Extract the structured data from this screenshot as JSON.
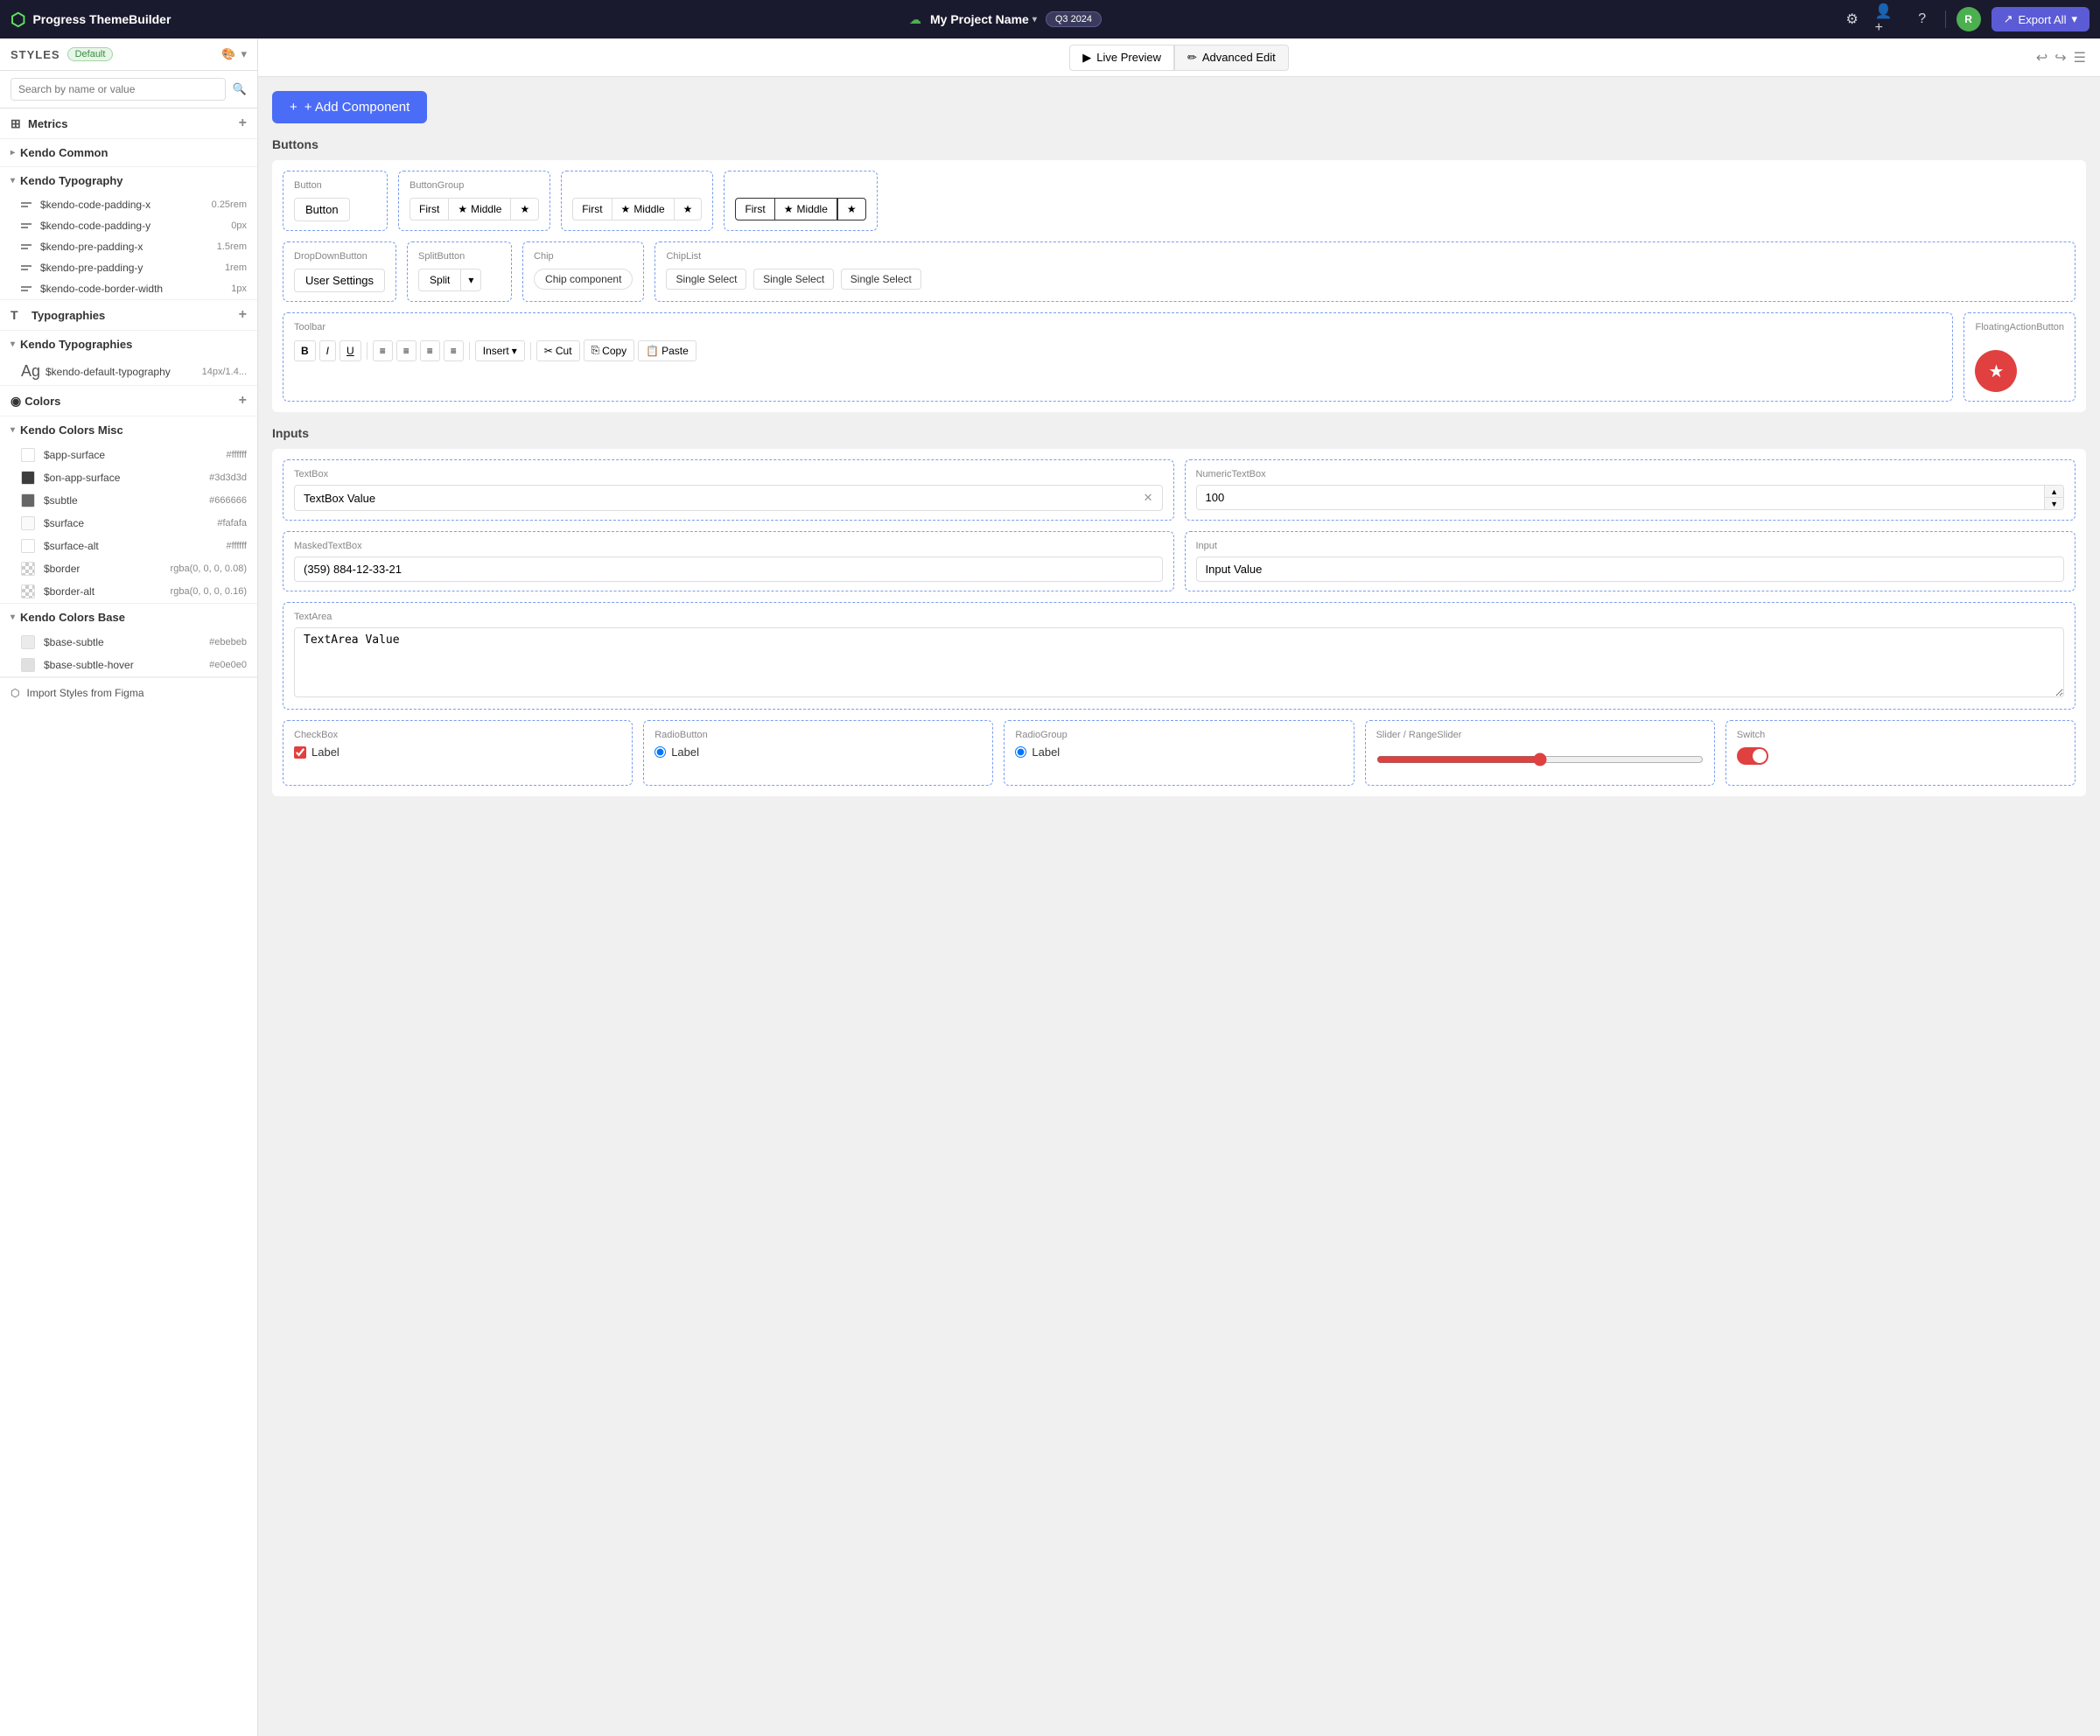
{
  "topnav": {
    "logo_text": "Progress ThemeBuilder",
    "project_name": "My Project Name",
    "quarter_badge": "Q3 2024",
    "export_label": "Export All"
  },
  "sidebar": {
    "styles_label": "STYLES",
    "default_badge": "Default",
    "search_placeholder": "Search by name or value",
    "sections": {
      "metrics_label": "Metrics",
      "kendo_common_label": "Kendo Common",
      "kendo_typography_label": "Kendo Typography",
      "typography_items": [
        {
          "name": "$kendo-code-padding-x",
          "value": "0.25rem"
        },
        {
          "name": "$kendo-code-padding-y",
          "value": "0px"
        },
        {
          "name": "$kendo-pre-padding-x",
          "value": "1.5rem"
        },
        {
          "name": "$kendo-pre-padding-y",
          "value": "1rem"
        },
        {
          "name": "$kendo-code-border-width",
          "value": "1px"
        }
      ],
      "typographies_label": "Typographies",
      "kendo_typographies_label": "Kendo Typographies",
      "kendo_default_typography": "$kendo-default-typography",
      "kendo_default_typography_value": "14px/1.4...",
      "colors_label": "Colors",
      "kendo_colors_misc_label": "Kendo Colors Misc",
      "color_items_misc": [
        {
          "name": "$app-surface",
          "value": "#ffffff",
          "color": "#ffffff",
          "checkered": false
        },
        {
          "name": "$on-app-surface",
          "value": "#3d3d3d",
          "color": "#3d3d3d",
          "checkered": false
        },
        {
          "name": "$subtle",
          "value": "#666666",
          "color": "#666666",
          "checkered": false
        },
        {
          "name": "$surface",
          "value": "#fafafa",
          "color": "#fafafa",
          "checkered": false
        },
        {
          "name": "$surface-alt",
          "value": "#ffffff",
          "color": "#ffffff",
          "checkered": false
        },
        {
          "name": "$border",
          "value": "rgba(0, 0, 0, 0.08)",
          "color": null,
          "checkered": true
        },
        {
          "name": "$border-alt",
          "value": "rgba(0, 0, 0, 0.16)",
          "color": null,
          "checkered": true
        }
      ],
      "kendo_colors_base_label": "Kendo Colors Base",
      "color_items_base": [
        {
          "name": "$base-subtle",
          "value": "#ebebeb",
          "color": "#ebebeb",
          "checkered": false
        },
        {
          "name": "$base-subtle-hover",
          "value": "#e0e0e0",
          "color": "#e0e0e0",
          "checkered": false
        }
      ],
      "import_figma_label": "Import Styles from Figma"
    }
  },
  "content_toolbar": {
    "live_preview_label": "Live Preview",
    "advanced_edit_label": "Advanced Edit"
  },
  "canvas": {
    "add_component_label": "+ Add Component",
    "buttons_section_label": "Buttons",
    "inputs_section_label": "Inputs",
    "components": {
      "button": {
        "label": "Button",
        "btn_text": "Button"
      },
      "button_group": {
        "label": "ButtonGroup",
        "items": [
          "First",
          "Middle",
          ""
        ]
      },
      "button_group2": {
        "items": [
          "First",
          "Middle",
          ""
        ]
      },
      "button_group3": {
        "items": [
          "First",
          "Middle",
          ""
        ]
      },
      "dropdown_button": {
        "label": "DropDownButton",
        "btn_text": "User Settings"
      },
      "split_button": {
        "label": "SplitButton",
        "btn_text": "Split"
      },
      "chip": {
        "label": "Chip",
        "text": "Chip component"
      },
      "chip_list": {
        "label": "ChipList",
        "items": [
          "Single Select",
          "Single Select",
          "Single Select"
        ]
      },
      "toolbar": {
        "label": "Toolbar",
        "insert_label": "Insert",
        "cut_label": "Cut",
        "copy_label": "Copy",
        "paste_label": "Paste"
      },
      "fab": {
        "label": "FloatingActionButton"
      },
      "textbox": {
        "label": "TextBox",
        "value": "TextBox Value"
      },
      "numeric": {
        "label": "NumericTextBox",
        "value": "100"
      },
      "masked": {
        "label": "MaskedTextBox",
        "value": "(359) 884-12-33-21"
      },
      "input": {
        "label": "Input",
        "value": "Input Value"
      },
      "textarea": {
        "label": "TextArea",
        "value": "TextArea Value"
      },
      "checkbox": {
        "label": "CheckBox",
        "item_label": "Label"
      },
      "radio": {
        "label": "RadioButton",
        "item_label": "Label"
      },
      "radio_group": {
        "label": "RadioGroup",
        "item_label": "Label"
      },
      "slider": {
        "label": "Slider / RangeSlider"
      },
      "switch_comp": {
        "label": "Switch"
      }
    }
  }
}
